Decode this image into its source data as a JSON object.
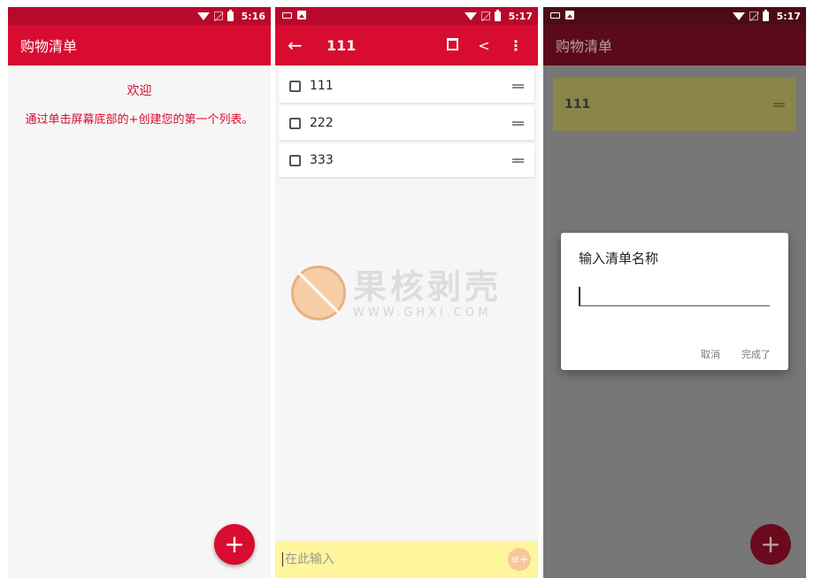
{
  "screen1": {
    "status": {
      "time": "5:16"
    },
    "appbar": {
      "title": "购物清单"
    },
    "welcome_title": "欢迎",
    "welcome_hint": "通过单击屏幕底部的+创建您的第一个列表。",
    "fab_label": "+"
  },
  "screen2": {
    "status": {
      "time": "5:17"
    },
    "appbar": {
      "back": "←",
      "title": "111",
      "share": "<",
      "more": "⋮"
    },
    "items": [
      {
        "label": "111"
      },
      {
        "label": "222"
      },
      {
        "label": "333"
      }
    ],
    "watermark": {
      "cn": "果核剥壳",
      "en": "WWW.GHXI.COM"
    },
    "input": {
      "placeholder": "在此输入",
      "add_icon": "≡+"
    }
  },
  "screen3": {
    "status": {
      "time": "5:17"
    },
    "appbar": {
      "title": "购物清单"
    },
    "list_item": "111",
    "fab_label": "+",
    "dialog": {
      "title": "输入清单名称",
      "cancel": "取消",
      "confirm": "完成了"
    }
  },
  "colors": {
    "primary": "#d80c30",
    "status_bar": "#b8092b",
    "input_bar": "#fff59d"
  }
}
